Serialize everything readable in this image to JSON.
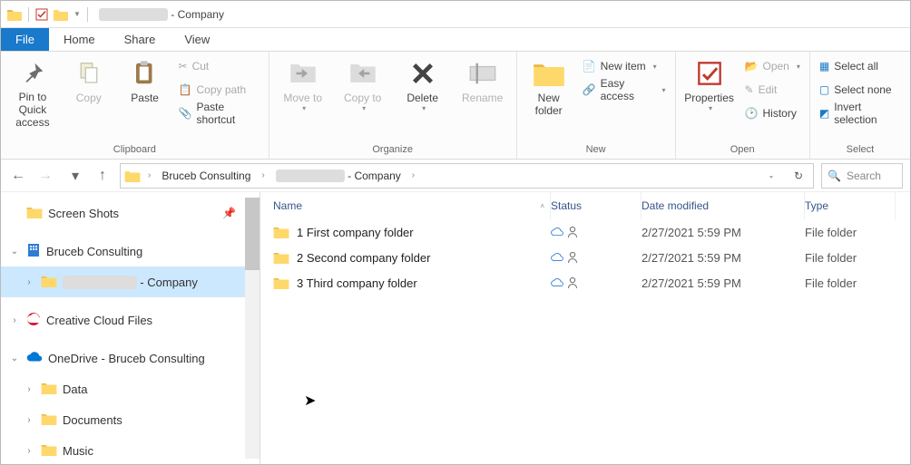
{
  "title": {
    "redacted": "████████",
    "suffix": "- Company"
  },
  "menu": {
    "file": "File",
    "home": "Home",
    "share": "Share",
    "view": "View"
  },
  "ribbon": {
    "pin": "Pin to Quick access",
    "copy": "Copy",
    "paste": "Paste",
    "cut": "Cut",
    "copy_path": "Copy path",
    "paste_shortcut": "Paste shortcut",
    "clipboard_label": "Clipboard",
    "move_to": "Move to",
    "copy_to": "Copy to",
    "delete": "Delete",
    "rename": "Rename",
    "organize_label": "Organize",
    "new_folder": "New folder",
    "new_item": "New item",
    "easy_access": "Easy access",
    "new_label": "New",
    "properties": "Properties",
    "open": "Open",
    "edit": "Edit",
    "history": "History",
    "open_label": "Open",
    "select_all": "Select all",
    "select_none": "Select none",
    "invert_selection": "Invert selection",
    "select_label": "Select"
  },
  "breadcrumbs": [
    "Bruceb Consulting",
    "████████",
    "- Company"
  ],
  "search_placeholder": "Search",
  "columns": {
    "name": "Name",
    "status": "Status",
    "date": "Date modified",
    "type": "Type"
  },
  "tree": [
    {
      "label": "Screen Shots",
      "icon": "folder",
      "pin": true
    },
    {
      "label": "Bruceb Consulting",
      "icon": "building",
      "expand": "open",
      "top": true
    },
    {
      "label": "████████ - Company",
      "icon": "folder",
      "expand": "closed",
      "indent": 1,
      "selected": true,
      "redactPrefix": true
    },
    {
      "label": "Creative Cloud Files",
      "icon": "cc",
      "expand": "closed",
      "top": true
    },
    {
      "label": "OneDrive - Bruceb Consulting",
      "icon": "onedrive",
      "expand": "open",
      "top": true
    },
    {
      "label": "Data",
      "icon": "folder",
      "expand": "closed",
      "indent": 1
    },
    {
      "label": "Documents",
      "icon": "folder",
      "expand": "closed",
      "indent": 1
    },
    {
      "label": "Music",
      "icon": "folder",
      "expand": "closed",
      "indent": 1
    }
  ],
  "files": [
    {
      "name": "1 First company folder",
      "date": "2/27/2021 5:59 PM",
      "type": "File folder"
    },
    {
      "name": "2 Second company folder",
      "date": "2/27/2021 5:59 PM",
      "type": "File folder"
    },
    {
      "name": "3 Third company folder",
      "date": "2/27/2021 5:59 PM",
      "type": "File folder"
    }
  ]
}
